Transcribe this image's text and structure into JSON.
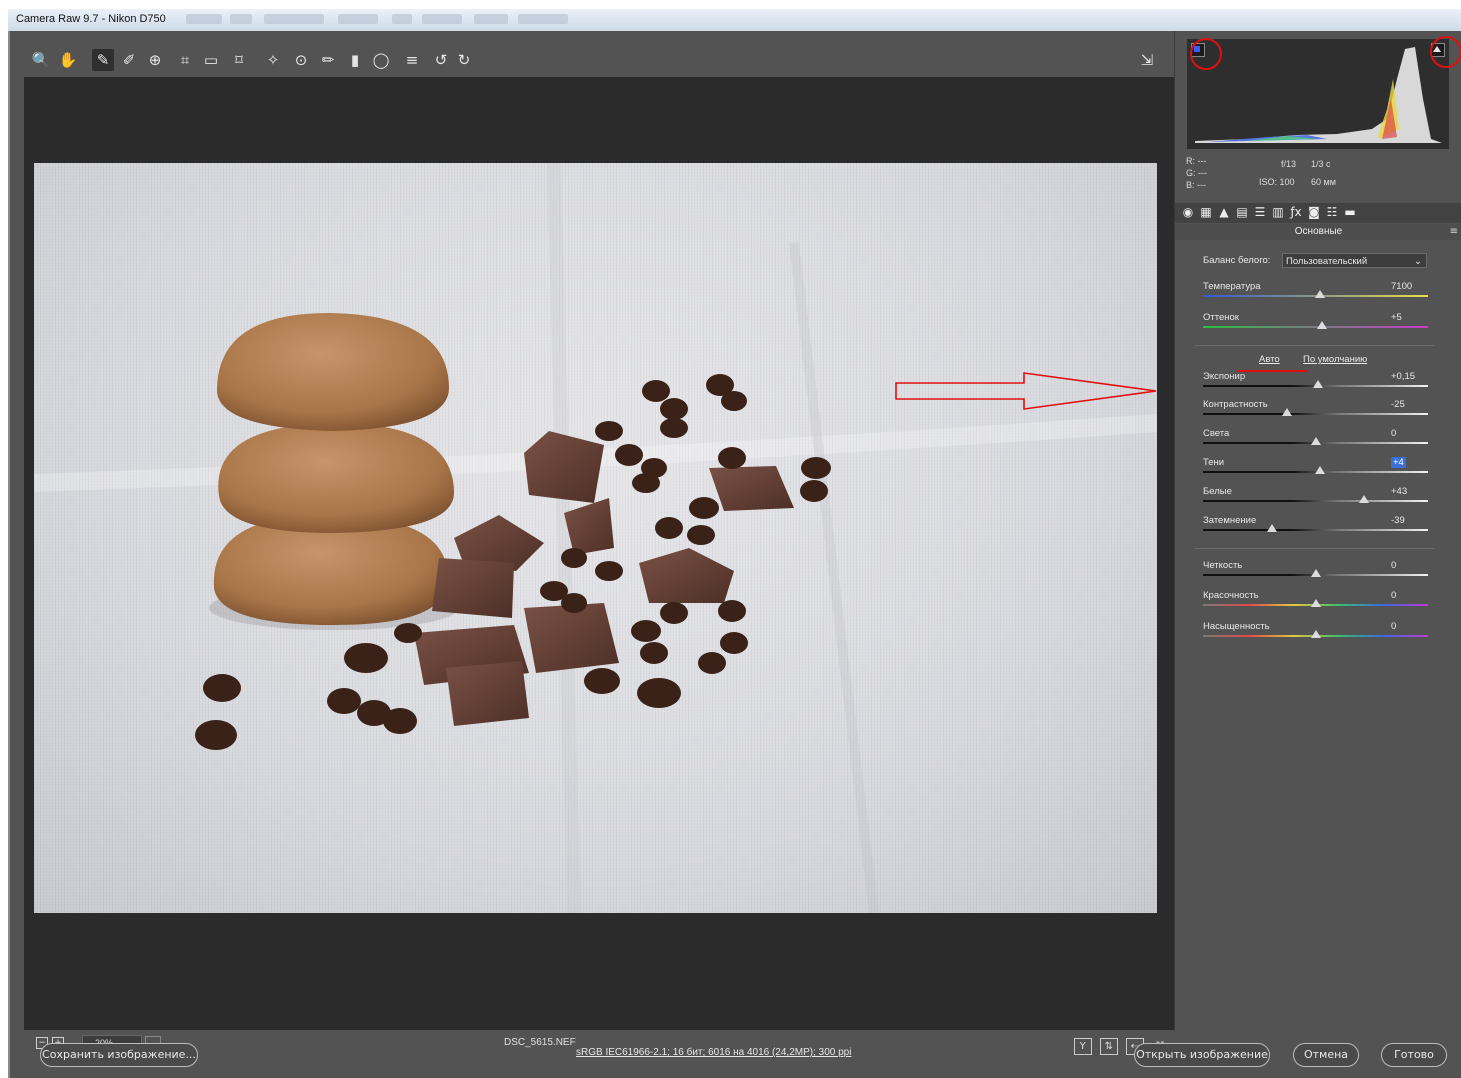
{
  "window": {
    "title": "Camera Raw 9.7  -  Nikon D750"
  },
  "toolbar": {
    "tools": [
      {
        "name": "zoom-tool",
        "glyph": "🔍"
      },
      {
        "name": "hand-tool",
        "glyph": "✋"
      },
      {
        "name": "white-balance-tool",
        "glyph": "✎"
      },
      {
        "name": "color-sampler-tool",
        "glyph": "✐"
      },
      {
        "name": "targeted-adjustment-tool",
        "glyph": "⊕"
      },
      {
        "name": "crop-tool",
        "glyph": "⌗"
      },
      {
        "name": "straighten-tool",
        "glyph": "▭"
      },
      {
        "name": "transform-tool",
        "glyph": "⌑"
      },
      {
        "name": "spot-removal-tool",
        "glyph": "✧"
      },
      {
        "name": "red-eye-tool",
        "glyph": "⊙"
      },
      {
        "name": "adjustment-brush-tool",
        "glyph": "✏"
      },
      {
        "name": "graduated-filter-tool",
        "glyph": "▮"
      },
      {
        "name": "radial-filter-tool",
        "glyph": "◯"
      },
      {
        "name": "preferences-tool",
        "glyph": "≡"
      },
      {
        "name": "rotate-left-tool",
        "glyph": "↺"
      },
      {
        "name": "rotate-right-tool",
        "glyph": "↻"
      }
    ],
    "fullscreen_glyph": "⇲"
  },
  "histogram": {
    "readout": {
      "r": "R:   ---",
      "g": "G:   ---",
      "b": "B:   ---"
    },
    "aperture": "f/13",
    "shutter": "1/3 с",
    "iso": "ISO: 100",
    "focal": "60 мм"
  },
  "panel_tabs": [
    "◉",
    "▦",
    "▲",
    "▤",
    "☰",
    "▥",
    "ƒx",
    "◙",
    "☷",
    "▬"
  ],
  "section_title": "Основные",
  "white_balance": {
    "label": "Баланс белого:",
    "value": "Пользовательский"
  },
  "sliders_top": [
    {
      "label": "Температура",
      "value": "7100",
      "pos": 0.52
    },
    {
      "label": "Оттенок",
      "value": "+5",
      "pos": 0.53
    }
  ],
  "links": {
    "auto": "Авто",
    "default": "По умолчанию"
  },
  "sliders_tone": [
    {
      "label": "Экспонир",
      "value": "+0,15",
      "pos": 0.51
    },
    {
      "label": "Контрастность",
      "value": "-25",
      "pos": 0.375
    },
    {
      "label": "Света",
      "value": "0",
      "pos": 0.5
    },
    {
      "label": "Тени",
      "value": "+4",
      "pos": 0.52,
      "highlight": true
    },
    {
      "label": "Белые",
      "value": "+43",
      "pos": 0.715
    },
    {
      "label": "Затемнение",
      "value": "-39",
      "pos": 0.305
    }
  ],
  "sliders_presence": [
    {
      "label": "Четкость",
      "value": "0",
      "pos": 0.5
    },
    {
      "label": "Красочность",
      "value": "0",
      "pos": 0.5
    },
    {
      "label": "Насыщенность",
      "value": "0",
      "pos": 0.5
    }
  ],
  "bottom": {
    "zoom": "20%",
    "filename": "DSC_5615.NEF",
    "workflow": "sRGB IEC61966-2.1; 16 бит; 6016 на 4016 (24,2МР); 300 ppi"
  },
  "footer": {
    "save": "Сохранить изображение...",
    "open": "Открыть изображение",
    "cancel": "Отмена",
    "done": "Готово"
  },
  "colors": {
    "panel": "#535353",
    "canvas": "#2b2b2b",
    "annotation": "#e01010",
    "highlight": "#3b6fd8"
  }
}
